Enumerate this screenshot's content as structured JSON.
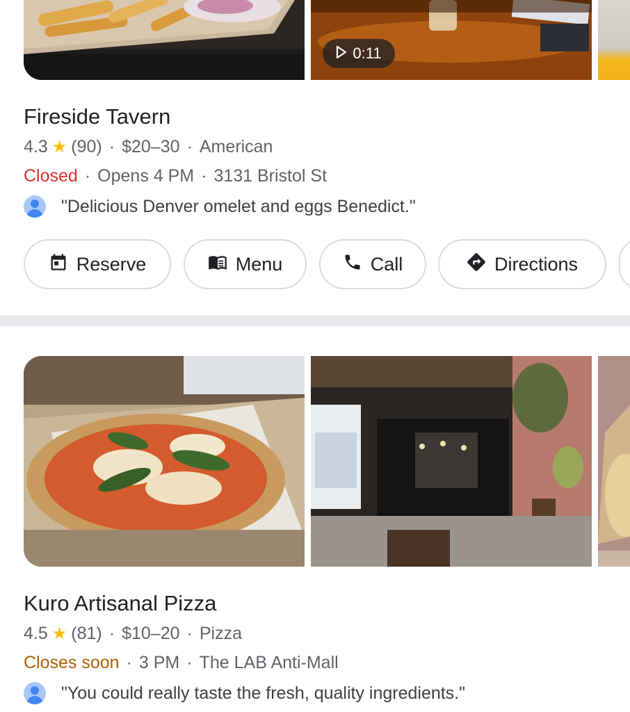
{
  "results": [
    {
      "name": "Fireside Tavern",
      "rating": "4.3",
      "reviews": "(90)",
      "price": "$20–30",
      "category": "American",
      "status": "Closed",
      "hours": "Opens 4 PM",
      "address": "3131 Bristol St",
      "review_snippet": "\"Delicious Denver omelet and eggs Benedict.\"",
      "video_duration": "0:11",
      "actions": {
        "reserve": "Reserve",
        "menu": "Menu",
        "call": "Call",
        "directions": "Directions"
      }
    },
    {
      "name": "Kuro Artisanal Pizza",
      "rating": "4.5",
      "reviews": "(81)",
      "price": "$10–20",
      "category": "Pizza",
      "status": "Closes soon",
      "hours": "3 PM",
      "address": "The LAB Anti-Mall",
      "review_snippet": "\"You could really taste the fresh, quality ingredients.\""
    }
  ],
  "separator": "·",
  "colors": {
    "star": "#fbbc04",
    "closed": "#d93025",
    "closes_soon": "#b06000",
    "meta_text": "#5f6368"
  }
}
